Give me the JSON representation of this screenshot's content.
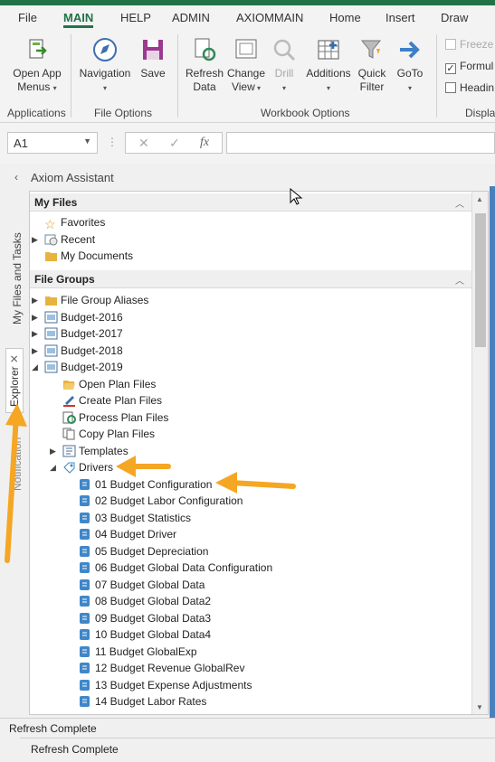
{
  "menu": {
    "tabs": [
      "File",
      "MAIN",
      "HELP",
      "ADMIN",
      "AXIOMMAIN",
      "Home",
      "Insert",
      "Draw"
    ],
    "active": "MAIN"
  },
  "ribbon": {
    "open_app_menus": "Open App\nMenus",
    "navigation": "Navigation",
    "save": "Save",
    "refresh_data": "Refresh\nData",
    "change_view": "Change\nView",
    "drill": "Drill",
    "additions": "Additions",
    "quick_filter": "Quick\nFilter",
    "goto": "GoTo",
    "groups": {
      "applications": "Applications",
      "file_options": "File Options",
      "workbook_options": "Workbook Options",
      "display": "Displa"
    },
    "checks": {
      "freeze": "Freeze",
      "formula": "Formul",
      "headings": "Headin"
    }
  },
  "formula_bar": {
    "name_box": "A1",
    "fx": "fx",
    "value": ""
  },
  "panel": {
    "title": "Axiom Assistant",
    "vtabs": {
      "my_files": "My Files and Tasks",
      "explorer": "Explorer",
      "notification": "Notification"
    },
    "my_files_header": "My Files",
    "my_files": [
      "Favorites",
      "Recent",
      "My Documents"
    ],
    "file_groups_header": "File Groups",
    "file_groups": [
      "File Group Aliases",
      "Budget-2016",
      "Budget-2017",
      "Budget-2018",
      "Budget-2019"
    ],
    "budget_2019_children": [
      "Open Plan Files",
      "Create Plan Files",
      "Process Plan Files",
      "Copy Plan Files",
      "Templates",
      "Drivers"
    ],
    "drivers": [
      "01 Budget Configuration",
      "02 Budget Labor Configuration",
      "03 Budget Statistics",
      "04 Budget Driver",
      "05 Budget Depreciation",
      "06 Budget Global Data Configuration",
      "07 Budget Global Data",
      "08 Budget Global Data2",
      "09 Budget Global Data3",
      "10 Budget Global Data4",
      "11 Budget GlobalExp",
      "12 Budget Revenue GlobalRev",
      "13 Budget Expense Adjustments",
      "14 Budget Labor Rates"
    ]
  },
  "status": {
    "inner": "Refresh Complete",
    "outer": "Refresh Complete"
  },
  "colors": {
    "accent": "#217346",
    "highlight_arrow": "#f5a623",
    "driver_icon": "#3f87c9"
  }
}
